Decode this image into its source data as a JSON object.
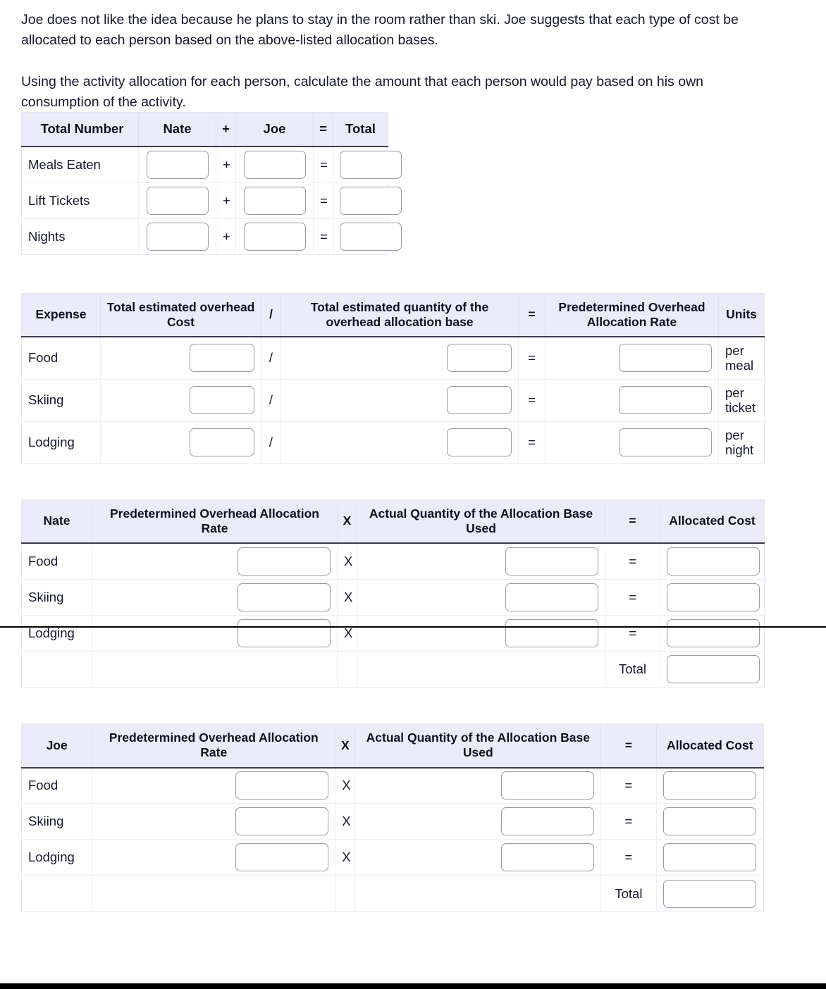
{
  "intro": {
    "paragraph_1": "Joe does not like the idea because he plans to stay in the room rather than ski. Joe suggests that each type of cost be allocated to each person based on the above-listed allocation bases.",
    "paragraph_2": "Using the activity allocation for each person, calculate the amount that each person would pay based on his own consumption of the activity."
  },
  "colors": {
    "header_background": "#ecebfa",
    "text": "#15172b",
    "input_border": "#9a9aa6",
    "header_rule": "#3b3b4a"
  },
  "total_number_table": {
    "headers": [
      "Total Number",
      "Nate",
      "+",
      "Joe",
      "=",
      "Total"
    ],
    "rows": [
      {
        "label": "Meals Eaten",
        "nate": "",
        "op1": "+",
        "joe": "",
        "op2": "=",
        "total": ""
      },
      {
        "label": "Lift Tickets",
        "nate": "",
        "op1": "+",
        "joe": "",
        "op2": "=",
        "total": ""
      },
      {
        "label": "Nights",
        "nate": "",
        "op1": "+",
        "joe": "",
        "op2": "=",
        "total": ""
      }
    ],
    "placeholder": ""
  },
  "rate_table": {
    "headers": [
      "Expense",
      "Total estimated overhead Cost",
      "/",
      "Total estimated quantity of the overhead allocation base",
      "=",
      "Predetermined Overhead Allocation Rate",
      "Units"
    ],
    "rows": [
      {
        "label": "Food",
        "cost": "",
        "op1": "/",
        "quantity": "",
        "op2": "=",
        "rate": "",
        "units": "per meal"
      },
      {
        "label": "Skiing",
        "cost": "",
        "op1": "/",
        "quantity": "",
        "op2": "=",
        "rate": "",
        "units": "per ticket"
      },
      {
        "label": "Lodging",
        "cost": "",
        "op1": "/",
        "quantity": "",
        "op2": "=",
        "rate": "",
        "units": "per night"
      }
    ],
    "placeholder": ""
  },
  "nate_table": {
    "headers": [
      "Nate",
      "Predetermined Overhead Allocation Rate",
      "X",
      "Actual Quantity of the Allocation Base Used",
      "=",
      "Allocated Cost"
    ],
    "rows": [
      {
        "label": "Food",
        "rate": "",
        "op1": "X",
        "quantity": "",
        "op2": "=",
        "cost": ""
      },
      {
        "label": "Skiing",
        "rate": "",
        "op1": "X",
        "quantity": "",
        "op2": "=",
        "cost": ""
      },
      {
        "label": "Lodging",
        "rate": "",
        "op1": "X",
        "quantity": "",
        "op2": "=",
        "cost": ""
      }
    ],
    "total_label": "Total",
    "total_value": "",
    "placeholder": ""
  },
  "joe_table": {
    "headers": [
      "Joe",
      "Predetermined Overhead Allocation Rate",
      "X",
      "Actual Quantity of the Allocation Base Used",
      "=",
      "Allocated Cost"
    ],
    "rows": [
      {
        "label": "Food",
        "rate": "",
        "op1": "X",
        "quantity": "",
        "op2": "=",
        "cost": ""
      },
      {
        "label": "Skiing",
        "rate": "",
        "op1": "X",
        "quantity": "",
        "op2": "=",
        "cost": ""
      },
      {
        "label": "Lodging",
        "rate": "",
        "op1": "X",
        "quantity": "",
        "op2": "=",
        "cost": ""
      }
    ],
    "total_label": "Total",
    "total_value": "",
    "placeholder": ""
  }
}
